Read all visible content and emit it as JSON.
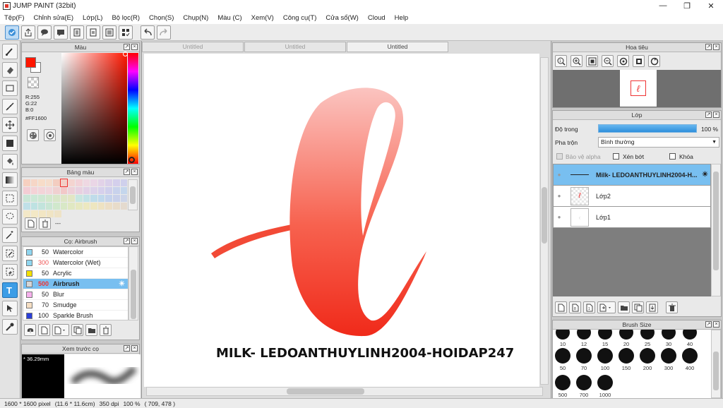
{
  "window": {
    "title": "JUMP PAINT (32bit)"
  },
  "menu": [
    "Tệp(F)",
    "Chỉnh sửa(E)",
    "Lớp(L)",
    "Bộ lọc(R)",
    "Chọn(S)",
    "Chụp(N)",
    "Màu (C)",
    "Xem(V)",
    "Công cụ(T)",
    "Cửa sổ(W)",
    "Cloud",
    "Help"
  ],
  "color_panel": {
    "title": "Màu",
    "r": "R:255",
    "g": "G:22",
    "b": "B:0",
    "hex": "#FF1600",
    "foreground": "#ff1600"
  },
  "palette_panel": {
    "title": "Bảng màu",
    "label": "---"
  },
  "brush_panel": {
    "title": "Cọ: Airbrush",
    "items": [
      {
        "size": "50",
        "name": "Watercolor",
        "color": "#8fd6f0"
      },
      {
        "size": "300",
        "name": "Watercolor (Wet)",
        "color": "#8fd6f0"
      },
      {
        "size": "50",
        "name": "Acrylic",
        "color": "#f3e000"
      },
      {
        "size": "500",
        "name": "Airbrush",
        "color": "#d6d6d6"
      },
      {
        "size": "50",
        "name": "Blur",
        "color": "#f6b0ec"
      },
      {
        "size": "70",
        "name": "Smudge",
        "color": "#f6dfc3"
      },
      {
        "size": "100",
        "name": "Sparkle Brush",
        "color": "#2b3fd8"
      }
    ]
  },
  "preview_panel": {
    "title": "Xem trước cọ",
    "size": "* 36.29mm"
  },
  "tabs": [
    "Untitled",
    "Untitled",
    "Untitled"
  ],
  "canvas_text": "MILK- LEDOANTHUYLINH2004-HOIDAP247",
  "navigator_panel": {
    "title": "Hoa tiêu"
  },
  "layer_panel": {
    "title": "Lớp",
    "opacity_label": "Độ trong",
    "opacity_value": "100 %",
    "opacity": 1.0,
    "blend_label": "Pha trộn",
    "blend_value": "Bình thường",
    "protect_alpha": "Bảo vệ alpha",
    "clipping": "Xén bớt",
    "lock": "Khóa",
    "layers": [
      {
        "name": "Milk- LEDOANTHUYLINH2004-H..."
      },
      {
        "name": "Lớp2"
      },
      {
        "name": "Lớp1"
      }
    ]
  },
  "brush_size_panel": {
    "title": "Brush Size",
    "sizes_row1": [
      "10",
      "12",
      "15",
      "20",
      "25",
      "30",
      "40"
    ],
    "sizes_row2": [
      "50",
      "70",
      "100",
      "150",
      "200",
      "300",
      "400"
    ],
    "sizes_row3": [
      "500",
      "700",
      "1000"
    ]
  },
  "status": {
    "dimensions": "1600 * 1600 pixel",
    "physical": "(11.6 * 11.6cm)",
    "dpi": "350 dpi",
    "zoom": "100 %",
    "coords": "( 709, 478 )"
  }
}
